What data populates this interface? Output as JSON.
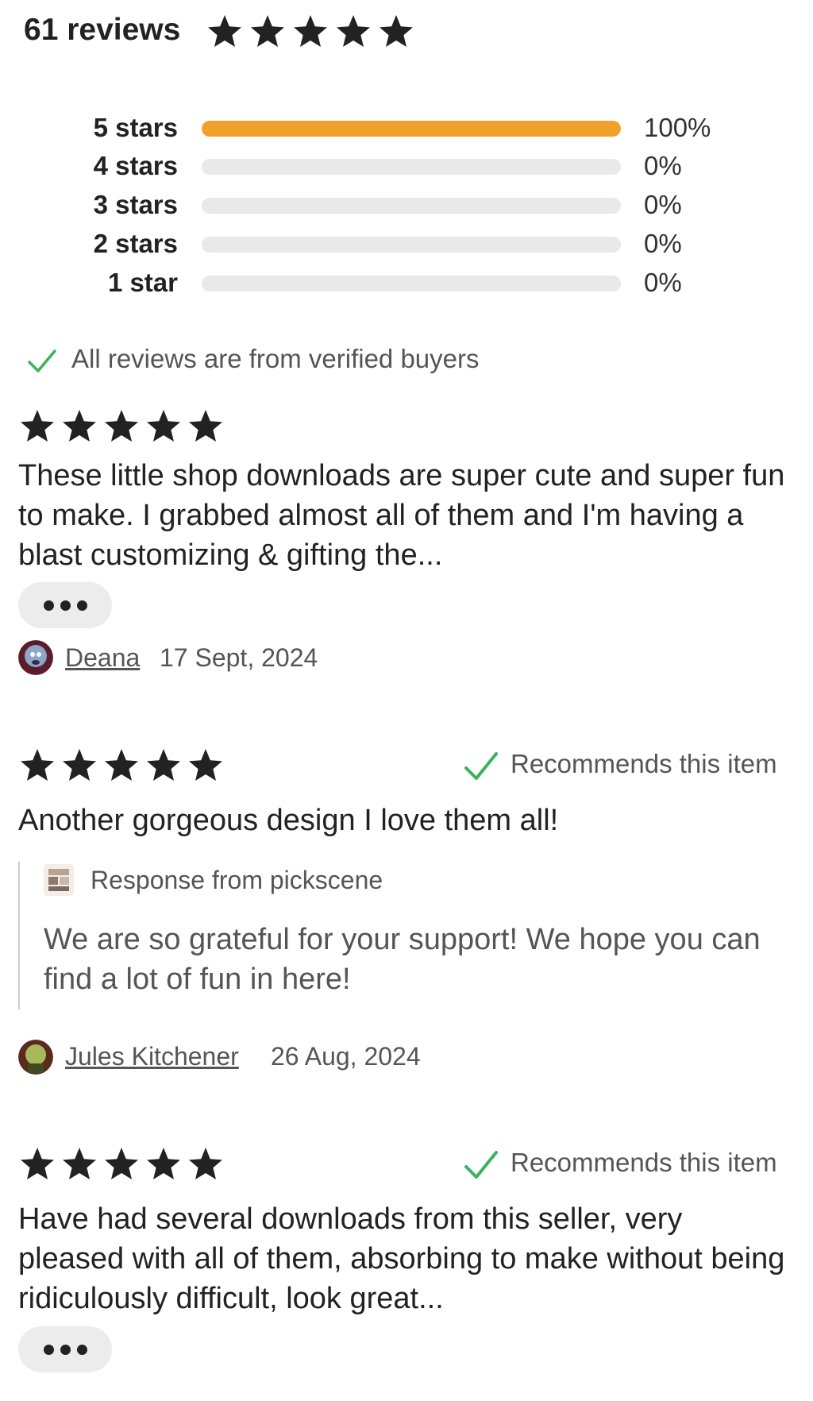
{
  "summary": {
    "count_label": "61 reviews",
    "average_rating": 5,
    "star_color": "#222222"
  },
  "distribution": [
    {
      "label": "5 stars",
      "percent_label": "100%",
      "fraction": 1.0
    },
    {
      "label": "4 stars",
      "percent_label": "0%",
      "fraction": 0.0
    },
    {
      "label": "3 stars",
      "percent_label": "0%",
      "fraction": 0.0
    },
    {
      "label": "2 stars",
      "percent_label": "0%",
      "fraction": 0.0
    },
    {
      "label": "1 star",
      "percent_label": "0%",
      "fraction": 0.0
    }
  ],
  "colors": {
    "bar_fill": "#f1a02b",
    "bar_track": "#e9e9e9",
    "check_green": "#3bb35b"
  },
  "verified": {
    "icon": "checkmark-icon",
    "text": "All reviews are from verified buyers"
  },
  "reviews": [
    {
      "rating": 5,
      "text": "These little shop downloads are super cute and super fun to make. I grabbed almost all of them and I'm having a blast customizing & gifting the...",
      "more_icon": "ellipsis-icon",
      "reviewer": "Deana",
      "date": "17 Sept, 2024"
    },
    {
      "rating": 5,
      "recommends": "Recommends this item",
      "text": "Another gorgeous design I love them all!",
      "response": {
        "title": "Response from pickscene",
        "text": "We are so grateful for your support! We hope you can find a lot of fun in here!"
      },
      "reviewer": "Jules Kitchener",
      "date": "26 Aug, 2024"
    },
    {
      "rating": 5,
      "recommends": "Recommends this item",
      "text": "Have had several downloads from this seller, very pleased with all of them, absorbing to make without being ridiculously difficult, look great...",
      "more_icon": "ellipsis-icon"
    }
  ]
}
